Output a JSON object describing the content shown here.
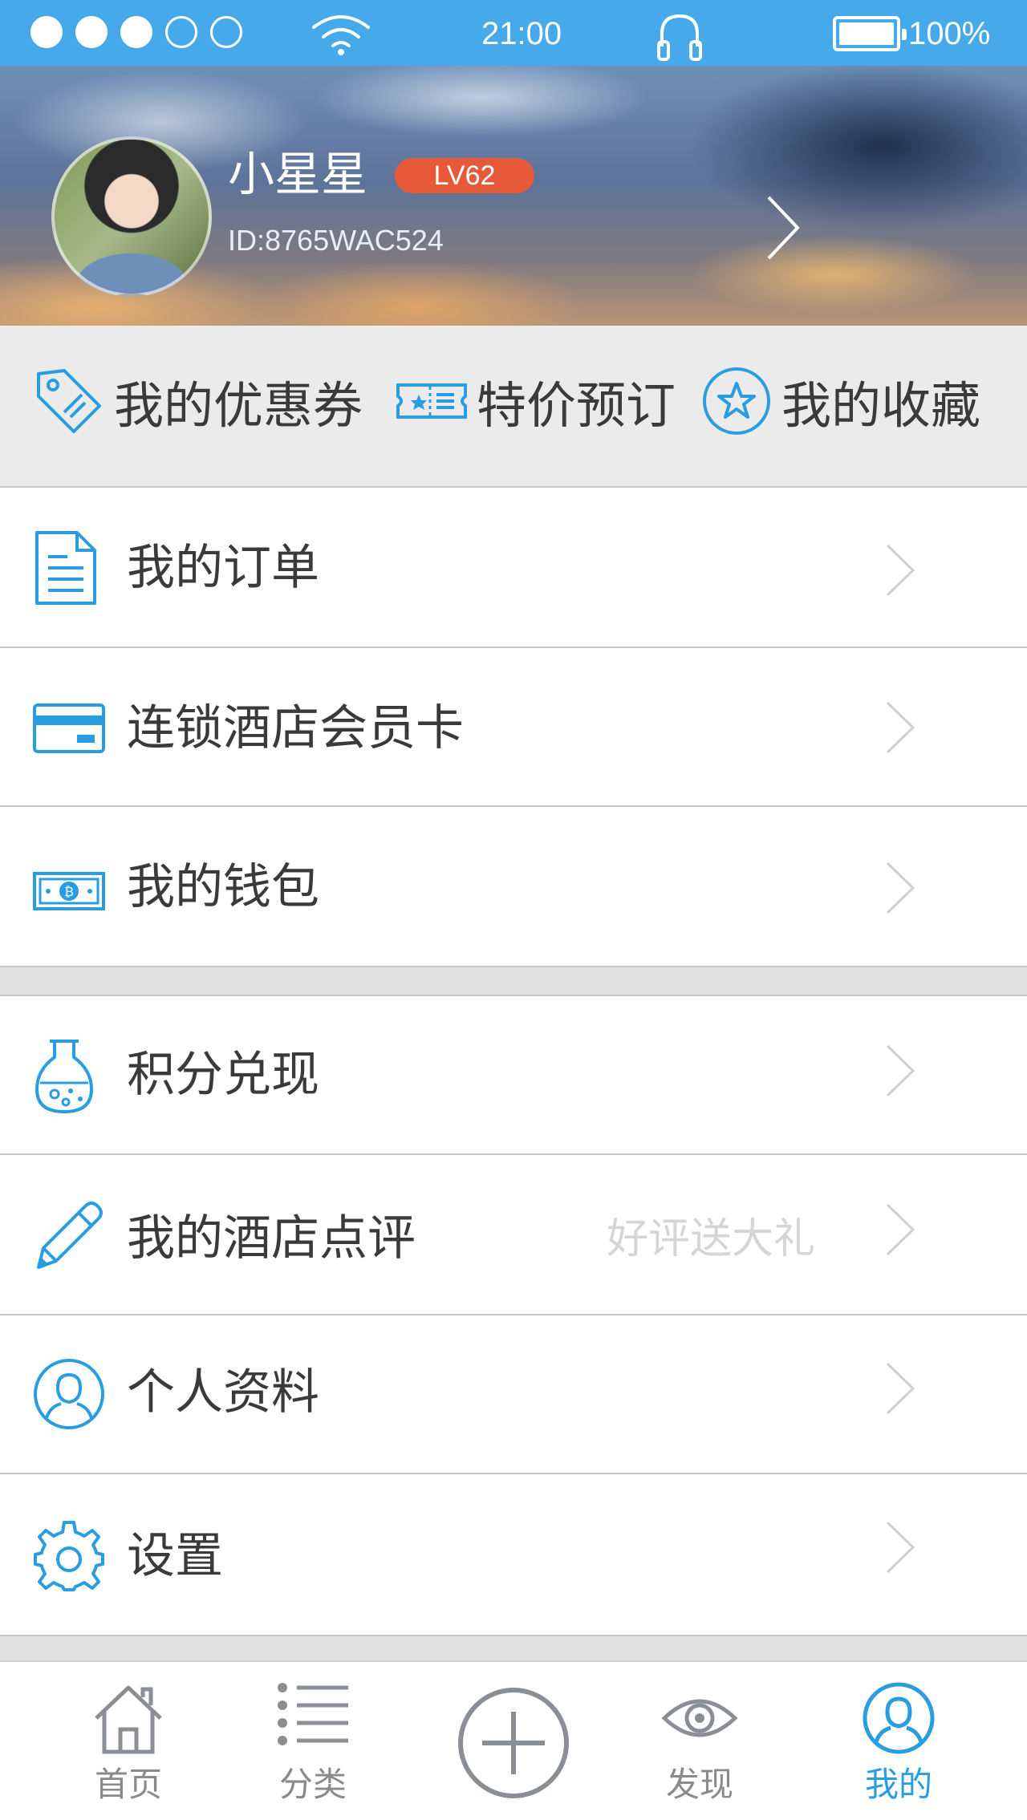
{
  "status_bar": {
    "time": "21:00",
    "battery": "100%"
  },
  "profile": {
    "name": "小星星",
    "level": "LV62",
    "user_id": "ID:8765WAC524"
  },
  "quick_actions": [
    {
      "label": "我的优惠券",
      "icon": "coupon-tag-icon"
    },
    {
      "label": "特价预订",
      "icon": "ticket-icon"
    },
    {
      "label": "我的收藏",
      "icon": "star-circle-icon"
    }
  ],
  "menu": [
    {
      "label": "我的订单",
      "icon": "document-icon",
      "hint": ""
    },
    {
      "label": "连锁酒店会员卡",
      "icon": "credit-card-icon",
      "hint": ""
    },
    {
      "label": "我的钱包",
      "icon": "bill-coin-icon",
      "hint": ""
    },
    {
      "label": "积分兑现",
      "icon": "flask-icon",
      "hint": ""
    },
    {
      "label": "我的酒店点评",
      "icon": "pencil-icon",
      "hint": "好评送大礼"
    },
    {
      "label": "个人资料",
      "icon": "user-circle-icon",
      "hint": ""
    },
    {
      "label": "设置",
      "icon": "gear-icon",
      "hint": ""
    }
  ],
  "tabbar": [
    {
      "label": "首页",
      "icon": "home-icon",
      "active": false
    },
    {
      "label": "分类",
      "icon": "list-icon",
      "active": false
    },
    {
      "label": "",
      "icon": "plus-circle-icon",
      "active": false
    },
    {
      "label": "发现",
      "icon": "eye-icon",
      "active": false
    },
    {
      "label": "我的",
      "icon": "user-circle-icon",
      "active": true
    }
  ],
  "colors": {
    "accent": "#2a9ce0",
    "status_bar": "#45a9ea",
    "level_badge": "#e65a3a"
  }
}
